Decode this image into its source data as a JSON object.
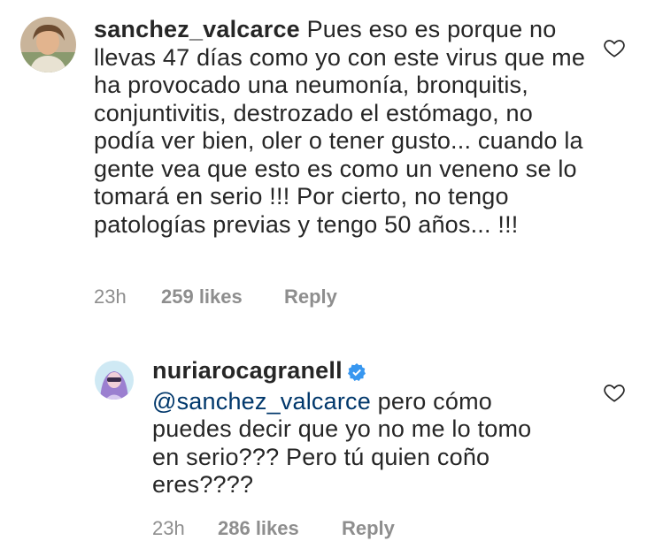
{
  "comments": [
    {
      "username": "sanchez_valcarce",
      "text": " Pues eso es porque no llevas 47 días como yo con este virus que me ha provocado una neumonía, bronquitis, conjuntivitis, destrozado el estómago, no podía ver bien, oler o tener gusto... cuando la gente vea que esto es como un veneno se lo tomará en serio !!! Por cierto, no tengo patologías previas y tengo 50 años... !!!",
      "time": "23h",
      "likes": "259 likes",
      "reply": "Reply",
      "like_icon": "heart-outline-icon"
    },
    {
      "username": "nuriarocagranell",
      "verified": true,
      "mention": "@sanchez_valcarce",
      "text": " pero cómo puedes decir que yo no me lo tomo en serio??? Pero tú quien coño eres????",
      "time": "23h",
      "likes": "286 likes",
      "reply": "Reply",
      "like_icon": "heart-outline-icon"
    }
  ],
  "colors": {
    "text": "#262626",
    "meta": "#8e8e8e",
    "mention": "#00376b",
    "verified": "#3897f0"
  }
}
